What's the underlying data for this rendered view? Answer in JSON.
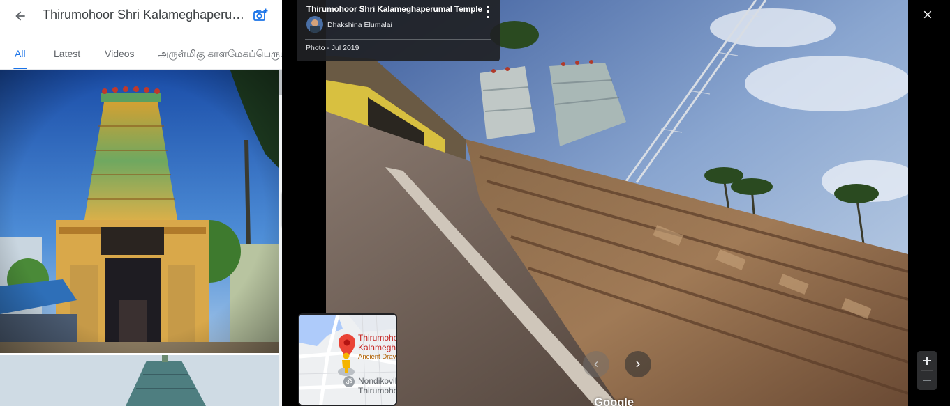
{
  "header": {
    "title": "Thirumohoor Shri Kalameghaperumal Temple",
    "back_icon": "arrow-back-icon",
    "add_photo_icon": "add-photo-camera-icon"
  },
  "tabs": [
    {
      "label": "All",
      "active": true
    },
    {
      "label": "Latest",
      "active": false
    },
    {
      "label": "Videos",
      "active": false
    },
    {
      "label": "அருள்மிகு காளமேகப்பெருமாள் திருக்கோயில்",
      "active": false
    }
  ],
  "viewer": {
    "photo_title": "Thirumohoor Shri Kalameghaperumal Temple",
    "author": "Dhakshina Elumalai",
    "date": "Photo - Jul 2019",
    "watermark": "Google",
    "minimap": {
      "place_line1": "Thirumohoor Shri",
      "place_line2": "Kalameghaperumal Temple",
      "place_sub": "Ancient Dravidian temple",
      "nearby_line1": "Nondikovil",
      "nearby_line2": "Thirumohoor"
    }
  },
  "colors": {
    "accent": "#1a73e8",
    "panel_bg": "#ffffff",
    "viewer_bg": "#000000",
    "info_card_bg": "#202124",
    "pin_red": "#ea4335"
  }
}
